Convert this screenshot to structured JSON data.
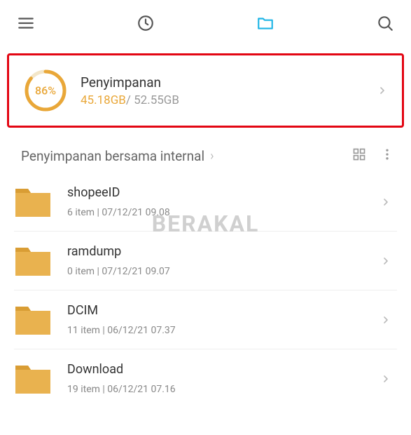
{
  "storage": {
    "title": "Penyimpanan",
    "percent": "86%",
    "used": "45.18GB",
    "separator": "/ ",
    "total": "52.55GB"
  },
  "breadcrumb": {
    "label": "Penyimpanan bersama internal"
  },
  "files": [
    {
      "name": "shopeeID",
      "meta": "6 item  |  07/12/21 09.08"
    },
    {
      "name": "ramdump",
      "meta": "0 item  |  07/12/21 09.07"
    },
    {
      "name": "DCIM",
      "meta": "11 item  |  06/12/21 07.37"
    },
    {
      "name": "Download",
      "meta": "19 item  |  06/12/21 07.16"
    }
  ],
  "watermark": "BERAKAL"
}
